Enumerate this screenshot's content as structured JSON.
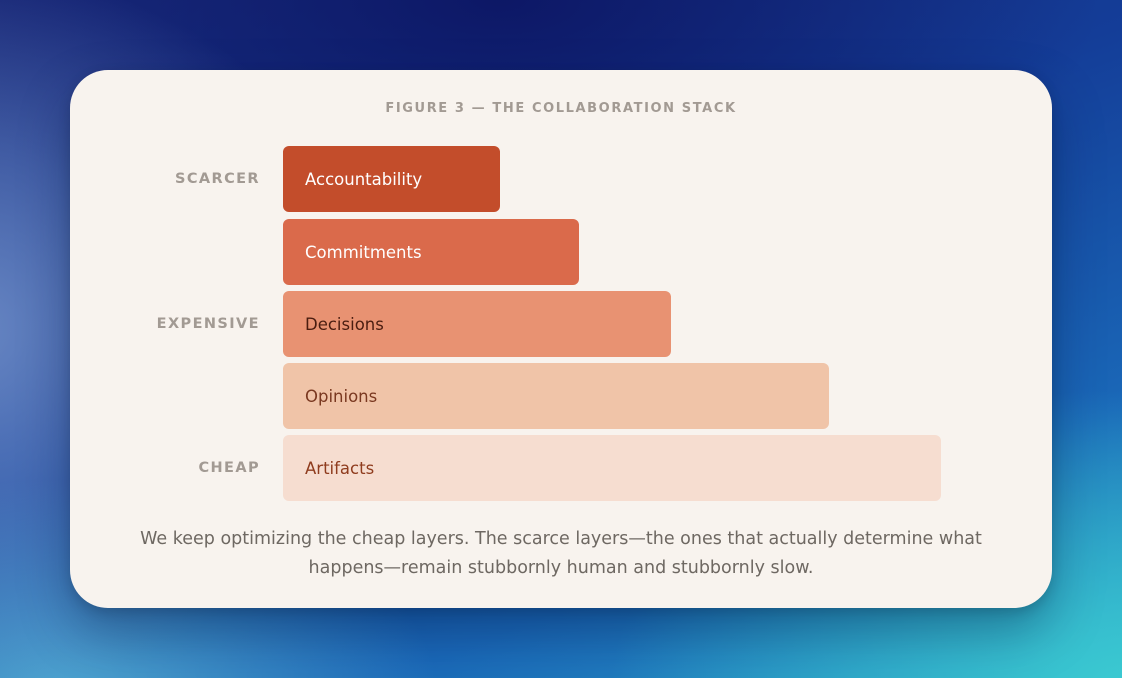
{
  "figure": {
    "title": "FIGURE 3 — THE COLLABORATION STACK",
    "caption": "We keep optimizing the cheap layers. The scarce layers—the ones that actually determine what happens—remain stubbornly human and stubbornly slow."
  },
  "tiers": [
    {
      "label": "SCARCER",
      "at_layer": "Accountability"
    },
    {
      "label": "EXPENSIVE",
      "at_layer": "Decisions"
    },
    {
      "label": "CHEAP",
      "at_layer": "Artifacts"
    }
  ],
  "layers": [
    {
      "label": "Accountability",
      "relative_width": 0.33,
      "fill": "#c34d2b",
      "text_color": "#ffffff"
    },
    {
      "label": "Commitments",
      "relative_width": 0.45,
      "fill": "#da6a4b",
      "text_color": "#ffffff"
    },
    {
      "label": "Decisions",
      "relative_width": 0.59,
      "fill": "#e89272",
      "text_color": "#4a1d10"
    },
    {
      "label": "Opinions",
      "relative_width": 0.83,
      "fill": "#f0c4a8",
      "text_color": "#7a3820"
    },
    {
      "label": "Artifacts",
      "relative_width": 1.0,
      "fill": "#f6ddd0",
      "text_color": "#8f3c1e"
    }
  ],
  "colors": {
    "card_background": "#f8f3ee",
    "label_gray": "#a29a93",
    "caption_gray": "#6e6862"
  }
}
